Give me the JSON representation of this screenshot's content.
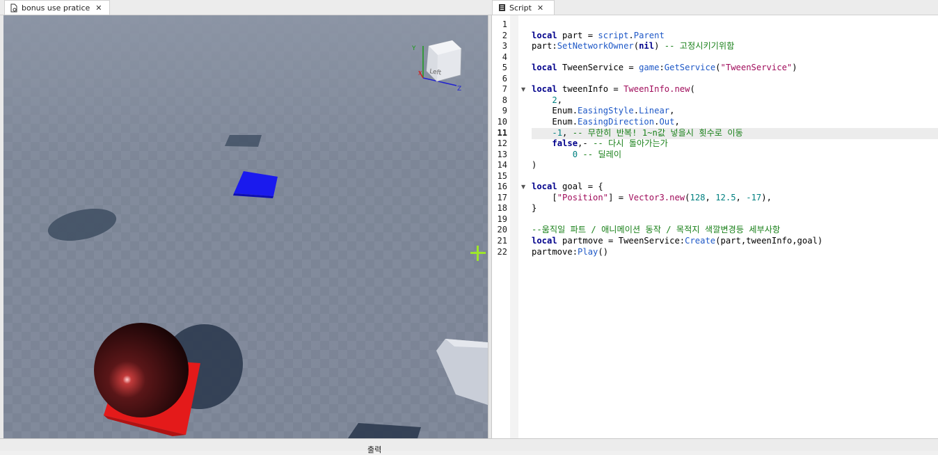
{
  "tabs": [
    {
      "label": "bonus use pratice",
      "icon": "place-document-icon"
    },
    {
      "label": "Script",
      "icon": "script-document-icon"
    }
  ],
  "tab_close_glyph": "✕",
  "viewport": {
    "view_cube_label": "Left",
    "axis_labels": {
      "y": "Y",
      "x": "X",
      "z": "Z"
    },
    "colors": {
      "sky": "#7c8595",
      "floor": "#7d8697",
      "blue_part": "#1a1aee",
      "red_part": "#e41a1a",
      "sphere": "#3a0f10"
    }
  },
  "editor": {
    "current_line": 11,
    "lines": [
      {
        "n": 1,
        "tokens": []
      },
      {
        "n": 2,
        "tokens": [
          [
            "kw",
            "local"
          ],
          [
            "t",
            " part = "
          ],
          [
            "bl",
            "script"
          ],
          [
            "t",
            "."
          ],
          [
            "bl",
            "Parent"
          ]
        ]
      },
      {
        "n": 3,
        "tokens": [
          [
            "t",
            "part:"
          ],
          [
            "bl",
            "SetNetworkOwner"
          ],
          [
            "t",
            "("
          ],
          [
            "kw",
            "nil"
          ],
          [
            "t",
            ") "
          ],
          [
            "cm",
            "-- 고정시키기위함"
          ]
        ]
      },
      {
        "n": 4,
        "tokens": []
      },
      {
        "n": 5,
        "tokens": [
          [
            "kw",
            "local"
          ],
          [
            "t",
            " TweenService = "
          ],
          [
            "bl",
            "game"
          ],
          [
            "t",
            ":"
          ],
          [
            "bl",
            "GetService"
          ],
          [
            "t",
            "("
          ],
          [
            "st",
            "\"TweenService\""
          ],
          [
            "t",
            ")"
          ]
        ]
      },
      {
        "n": 6,
        "tokens": []
      },
      {
        "n": 7,
        "fold": true,
        "tokens": [
          [
            "kw",
            "local"
          ],
          [
            "t",
            " tweenInfo = "
          ],
          [
            "mg",
            "TweenInfo.new"
          ],
          [
            "t",
            "("
          ]
        ]
      },
      {
        "n": 8,
        "tokens": [
          [
            "t",
            "    "
          ],
          [
            "nm",
            "2"
          ],
          [
            "t",
            ","
          ]
        ]
      },
      {
        "n": 9,
        "tokens": [
          [
            "t",
            "    Enum."
          ],
          [
            "bl",
            "EasingStyle"
          ],
          [
            "t",
            "."
          ],
          [
            "bl",
            "Linear"
          ],
          [
            "t",
            ","
          ]
        ]
      },
      {
        "n": 10,
        "tokens": [
          [
            "t",
            "    Enum."
          ],
          [
            "bl",
            "EasingDirection"
          ],
          [
            "t",
            "."
          ],
          [
            "bl",
            "Out"
          ],
          [
            "t",
            ","
          ]
        ]
      },
      {
        "n": 11,
        "tokens": [
          [
            "t",
            "    "
          ],
          [
            "nm",
            "-1"
          ],
          [
            "t",
            ", "
          ],
          [
            "cm",
            "-- 무한히 반복! 1~n값 넣을시 횟수로 이동"
          ]
        ]
      },
      {
        "n": 12,
        "tokens": [
          [
            "t",
            "    "
          ],
          [
            "kw",
            "false"
          ],
          [
            "t",
            ",- "
          ],
          [
            "cm",
            "-- 다시 돌아가는가"
          ]
        ]
      },
      {
        "n": 13,
        "tokens": [
          [
            "t",
            "        "
          ],
          [
            "nm",
            "0"
          ],
          [
            "t",
            " "
          ],
          [
            "cm",
            "-- 딜레이"
          ]
        ]
      },
      {
        "n": 14,
        "tokens": [
          [
            "t",
            ")"
          ]
        ]
      },
      {
        "n": 15,
        "tokens": []
      },
      {
        "n": 16,
        "fold": true,
        "tokens": [
          [
            "kw",
            "local"
          ],
          [
            "t",
            " goal = {"
          ]
        ]
      },
      {
        "n": 17,
        "tokens": [
          [
            "t",
            "    ["
          ],
          [
            "st",
            "\"Position\""
          ],
          [
            "t",
            "] = "
          ],
          [
            "mg",
            "Vector3.new"
          ],
          [
            "t",
            "("
          ],
          [
            "nm",
            "128"
          ],
          [
            "t",
            ", "
          ],
          [
            "nm",
            "12.5"
          ],
          [
            "t",
            ", "
          ],
          [
            "nm",
            "-17"
          ],
          [
            "t",
            "),"
          ]
        ]
      },
      {
        "n": 18,
        "tokens": [
          [
            "t",
            "}"
          ]
        ]
      },
      {
        "n": 19,
        "tokens": []
      },
      {
        "n": 20,
        "tokens": [
          [
            "cm",
            "--움직일 파트 / 애니메이션 동작 / 목적지 색깔변경등 세부사항"
          ]
        ]
      },
      {
        "n": 21,
        "tokens": [
          [
            "kw",
            "local"
          ],
          [
            "t",
            " partmove = TweenService:"
          ],
          [
            "bl",
            "Create"
          ],
          [
            "t",
            "(part,tweenInfo,goal)"
          ]
        ]
      },
      {
        "n": 22,
        "tokens": [
          [
            "t",
            "partmove:"
          ],
          [
            "bl",
            "Play"
          ],
          [
            "t",
            "()"
          ]
        ]
      }
    ]
  },
  "bottom_panel_label": "출력"
}
